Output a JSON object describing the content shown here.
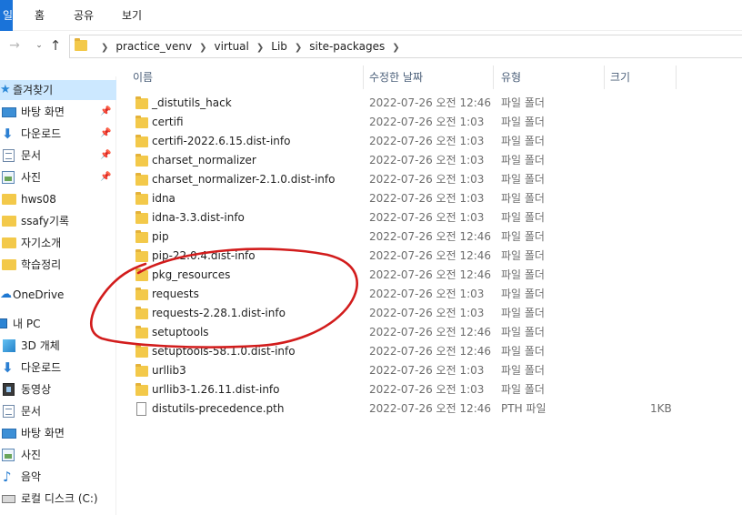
{
  "ribbon": {
    "file_tab": "일",
    "home_tab": "홈",
    "share_tab": "공유",
    "view_tab": "보기"
  },
  "nav": {
    "forward_icon": "→",
    "dropdown_icon": "⌄",
    "up_icon": "↑"
  },
  "address": {
    "crumbs": [
      "practice_venv",
      "virtual",
      "Lib",
      "site-packages"
    ]
  },
  "sidebar": {
    "items": [
      {
        "label": "즐겨찾기",
        "icon": "star-icon",
        "pinned": false
      },
      {
        "label": "바탕 화면",
        "icon": "desktop-icon",
        "pinned": true
      },
      {
        "label": "다운로드",
        "icon": "download-icon",
        "pinned": true
      },
      {
        "label": "문서",
        "icon": "document-icon",
        "pinned": true
      },
      {
        "label": "사진",
        "icon": "pictures-icon",
        "pinned": true
      },
      {
        "label": "hws08",
        "icon": "folder-icon",
        "pinned": false
      },
      {
        "label": "ssafy기록",
        "icon": "folder-icon",
        "pinned": false
      },
      {
        "label": "자기소개",
        "icon": "folder-icon",
        "pinned": false
      },
      {
        "label": "학습정리",
        "icon": "folder-icon",
        "pinned": false
      },
      {
        "label": "OneDrive",
        "icon": "cloud-icon",
        "pinned": false
      },
      {
        "label": "내 PC",
        "icon": "pc-icon",
        "pinned": false
      },
      {
        "label": "3D 개체",
        "icon": "3d-objects-icon",
        "pinned": false
      },
      {
        "label": "다운로드",
        "icon": "download-icon",
        "pinned": false
      },
      {
        "label": "동영상",
        "icon": "video-icon",
        "pinned": false
      },
      {
        "label": "문서",
        "icon": "document-icon",
        "pinned": false
      },
      {
        "label": "바탕 화면",
        "icon": "desktop-icon",
        "pinned": false
      },
      {
        "label": "사진",
        "icon": "pictures-icon",
        "pinned": false
      },
      {
        "label": "음악",
        "icon": "music-icon",
        "pinned": false
      },
      {
        "label": "로컬 디스크 (C:)",
        "icon": "disk-icon",
        "pinned": false
      }
    ]
  },
  "columns": {
    "name": "이름",
    "modified": "수정한 날짜",
    "type": "유형",
    "size": "크기"
  },
  "files": [
    {
      "name": "_distutils_hack",
      "date": "2022-07-26 오전 12:46",
      "type": "파일 폴더",
      "size": ""
    },
    {
      "name": "certifi",
      "date": "2022-07-26 오전 1:03",
      "type": "파일 폴더",
      "size": ""
    },
    {
      "name": "certifi-2022.6.15.dist-info",
      "date": "2022-07-26 오전 1:03",
      "type": "파일 폴더",
      "size": ""
    },
    {
      "name": "charset_normalizer",
      "date": "2022-07-26 오전 1:03",
      "type": "파일 폴더",
      "size": ""
    },
    {
      "name": "charset_normalizer-2.1.0.dist-info",
      "date": "2022-07-26 오전 1:03",
      "type": "파일 폴더",
      "size": ""
    },
    {
      "name": "idna",
      "date": "2022-07-26 오전 1:03",
      "type": "파일 폴더",
      "size": ""
    },
    {
      "name": "idna-3.3.dist-info",
      "date": "2022-07-26 오전 1:03",
      "type": "파일 폴더",
      "size": ""
    },
    {
      "name": "pip",
      "date": "2022-07-26 오전 12:46",
      "type": "파일 폴더",
      "size": ""
    },
    {
      "name": "pip-22.0.4.dist-info",
      "date": "2022-07-26 오전 12:46",
      "type": "파일 폴더",
      "size": ""
    },
    {
      "name": "pkg_resources",
      "date": "2022-07-26 오전 12:46",
      "type": "파일 폴더",
      "size": ""
    },
    {
      "name": "requests",
      "date": "2022-07-26 오전 1:03",
      "type": "파일 폴더",
      "size": ""
    },
    {
      "name": "requests-2.28.1.dist-info",
      "date": "2022-07-26 오전 1:03",
      "type": "파일 폴더",
      "size": ""
    },
    {
      "name": "setuptools",
      "date": "2022-07-26 오전 12:46",
      "type": "파일 폴더",
      "size": ""
    },
    {
      "name": "setuptools-58.1.0.dist-info",
      "date": "2022-07-26 오전 12:46",
      "type": "파일 폴더",
      "size": ""
    },
    {
      "name": "urllib3",
      "date": "2022-07-26 오전 1:03",
      "type": "파일 폴더",
      "size": ""
    },
    {
      "name": "urllib3-1.26.11.dist-info",
      "date": "2022-07-26 오전 1:03",
      "type": "파일 폴더",
      "size": ""
    },
    {
      "name": "distutils-precedence.pth",
      "date": "2022-07-26 오전 12:46",
      "type": "PTH 파일",
      "size": "1KB"
    }
  ],
  "colors": {
    "selection": "#cce8ff",
    "folder": "#f3c94a",
    "annotation": "#d21c1c",
    "header_text": "#4c607a"
  }
}
